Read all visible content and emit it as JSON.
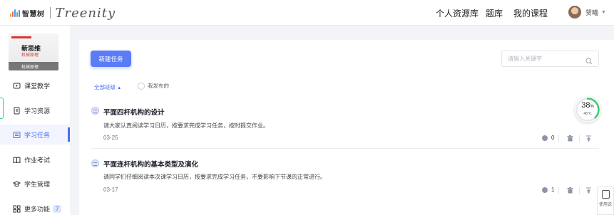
{
  "header": {
    "logo_cn": "智慧树",
    "logo_en": "Treenity",
    "nav": [
      "个人资源库",
      "题库",
      "我的课程"
    ],
    "user_name": "贺曦"
  },
  "sidebar": {
    "cover": {
      "title": "新思维",
      "subtitle": "机械原理",
      "band": "机械原理"
    },
    "items": [
      {
        "label": "课堂教学",
        "icon": "tv-icon"
      },
      {
        "label": "学习资源",
        "icon": "document-icon"
      },
      {
        "label": "学习任务",
        "icon": "task-list-icon",
        "active": true
      },
      {
        "label": "作业考试",
        "icon": "book-icon"
      },
      {
        "label": "学生管理",
        "icon": "student-icon"
      },
      {
        "label": "更多功能",
        "icon": "grid-icon",
        "badge": "7"
      }
    ]
  },
  "main": {
    "new_task_label": "新建任务",
    "search_placeholder": "请输入关键字",
    "filter_all_label": "全部班级",
    "filter_mine_label": "我发布的",
    "tasks": [
      {
        "title": "平面四杆机构的设计",
        "desc": "请大家认真阅读学习日历，按要求完成学习任务，按时提交作业。",
        "date": "03-25",
        "count": "0"
      },
      {
        "title": "平面连杆机构的基本类型及演化",
        "desc": "请同学们仔细阅读本次课学习日历，按要求完成学习任务，不要影响下节课的正常进行。",
        "date": "03-17",
        "count": "1"
      }
    ]
  },
  "gauge": {
    "percent": "38",
    "unit": "%",
    "temp": "46°C",
    "value": 0.38,
    "color": "#3cc870"
  },
  "usage": {
    "label": "使用说"
  },
  "colors": {
    "accent": "#4a6cf7",
    "button": "#5b7cf5"
  }
}
